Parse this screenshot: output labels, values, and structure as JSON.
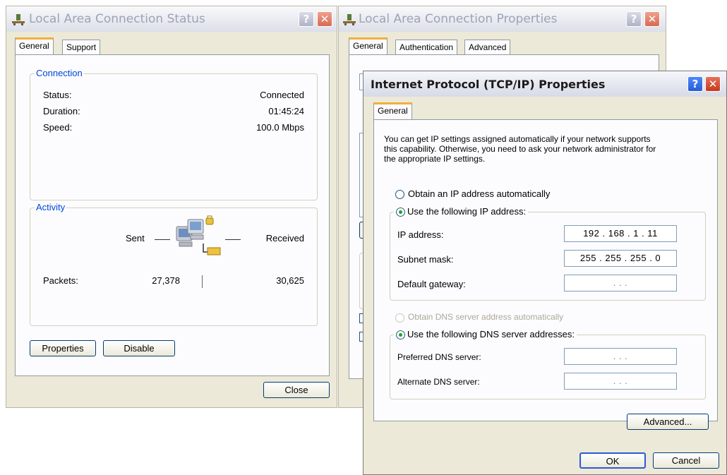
{
  "status_window": {
    "title": "Local Area Connection Status",
    "tabs": [
      "General",
      "Support"
    ],
    "connection": {
      "label": "Connection",
      "status_label": "Status:",
      "status_value": "Connected",
      "duration_label": "Duration:",
      "duration_value": "01:45:24",
      "speed_label": "Speed:",
      "speed_value": "100.0 Mbps"
    },
    "activity": {
      "label": "Activity",
      "sent_label": "Sent",
      "received_label": "Received",
      "packets_label": "Packets:",
      "packets_sent": "27,378",
      "packets_received": "30,625"
    },
    "buttons": {
      "properties": "Properties",
      "disable": "Disable",
      "close": "Close"
    }
  },
  "properties_window": {
    "title": "Local Area Connection Properties",
    "tabs": [
      "General",
      "Authentication",
      "Advanced"
    ]
  },
  "tcpip_window": {
    "title": "Internet Protocol (TCP/IP) Properties",
    "tab": "General",
    "intro_line1": "You can get IP settings assigned automatically if your network supports",
    "intro_line2": "this capability. Otherwise, you need to ask your network administrator for",
    "intro_line3": "the appropriate IP settings.",
    "obtain_ip_auto": "Obtain an IP address automatically",
    "use_following_ip": "Use the following IP address:",
    "ip_address_label": "IP address:",
    "ip_address_value": "192 . 168 .   1  .  11",
    "subnet_mask_label": "Subnet mask:",
    "subnet_mask_value": "255 . 255 . 255 .   0",
    "default_gateway_label": "Default gateway:",
    "empty_ip_value": ".       .       .",
    "obtain_dns_auto": "Obtain DNS server address automatically",
    "use_following_dns": "Use the following DNS server addresses:",
    "preferred_dns_label": "Preferred DNS server:",
    "alternate_dns_label": "Alternate DNS server:",
    "buttons": {
      "advanced": "Advanced...",
      "ok": "OK",
      "cancel": "Cancel"
    },
    "ip_mode": "manual",
    "dns_mode": "manual"
  },
  "colors": {
    "window_bg": "#ece9d8",
    "group_label": "#0046d5",
    "close_button": "#c53a1d",
    "help_button": "#2a5bd8",
    "tab_accent": "#f0b040",
    "radio_dot": "#21a121"
  }
}
